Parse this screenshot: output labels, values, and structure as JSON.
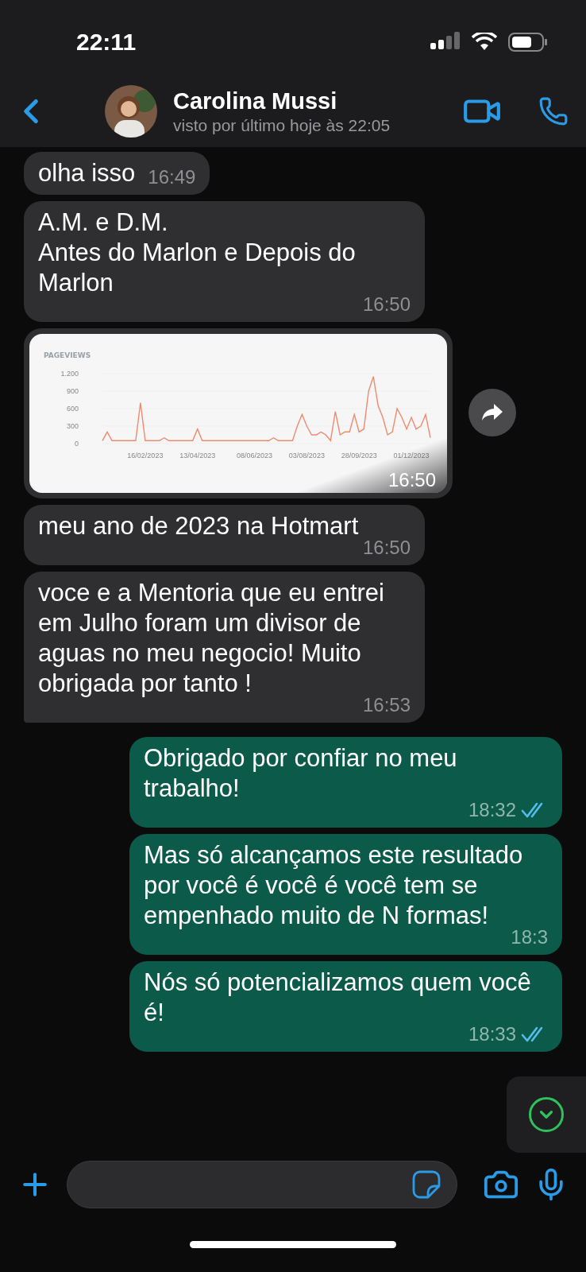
{
  "status_bar": {
    "time": "22:11"
  },
  "header": {
    "name": "Carolina Mussi",
    "last_seen": "visto por último hoje às 22:05"
  },
  "messages": [
    {
      "kind": "text",
      "outgoing": false,
      "text": "olha isso",
      "time": "16:49",
      "tail": false
    },
    {
      "kind": "text",
      "outgoing": false,
      "text": "A.M. e D.M.\nAntes do Marlon e Depois do Marlon",
      "time": "16:50",
      "tail": false
    },
    {
      "kind": "image",
      "outgoing": false,
      "time": "16:50",
      "chart_data": {
        "type": "line",
        "title": "PAGEVIEWS",
        "categories": [
          null,
          null,
          null,
          null,
          null,
          null,
          null,
          null,
          null,
          "16/02/2023",
          null,
          null,
          null,
          null,
          null,
          null,
          null,
          null,
          null,
          null,
          "13/04/2023",
          null,
          null,
          null,
          null,
          null,
          null,
          null,
          null,
          null,
          null,
          null,
          "08/06/2023",
          null,
          null,
          null,
          null,
          null,
          null,
          null,
          null,
          null,
          null,
          "03/08/2023",
          null,
          null,
          null,
          null,
          null,
          null,
          null,
          null,
          null,
          null,
          "28/09/2023",
          null,
          null,
          null,
          null,
          null,
          null,
          null,
          null,
          null,
          null,
          "01/12/2023",
          null,
          null,
          null,
          null
        ],
        "series": [
          {
            "color": "#ef8a6f",
            "values": [
              50,
              200,
              50,
              50,
              50,
              50,
              50,
              50,
              700,
              50,
              50,
              50,
              50,
              100,
              50,
              50,
              50,
              50,
              50,
              50,
              250,
              50,
              50,
              50,
              50,
              50,
              50,
              50,
              50,
              50,
              50,
              50,
              50,
              50,
              50,
              50,
              100,
              50,
              50,
              50,
              50,
              300,
              500,
              300,
              150,
              150,
              200,
              150,
              50,
              550,
              150,
              200,
              200,
              500,
              200,
              250,
              900,
              1150,
              650,
              450,
              150,
              200,
              600,
              450,
              250,
              450,
              250,
              300,
              500,
              100
            ]
          }
        ],
        "ylim": [
          0,
          1200
        ],
        "yticks": [
          0,
          300,
          600,
          900,
          {
            "value": 1200,
            "label": "1.200"
          }
        ]
      }
    },
    {
      "kind": "text",
      "outgoing": false,
      "text": "meu ano de 2023 na Hotmart",
      "time": "16:50",
      "tail": false
    },
    {
      "kind": "text",
      "outgoing": false,
      "text": "voce e a Mentoria que eu entrei em Julho foram um divisor de aguas no meu negocio! Muito obrigada por tanto !",
      "time": "16:53",
      "tail": true
    },
    {
      "kind": "text",
      "outgoing": true,
      "text": "Obrigado por confiar no meu trabalho!",
      "time": "18:32",
      "read": true,
      "tail": false
    },
    {
      "kind": "text",
      "outgoing": true,
      "text": "Mas só alcançamos este resultado por você é você é você tem se empenhado muito de N formas!",
      "time": "18:3",
      "tail": false
    },
    {
      "kind": "text",
      "outgoing": true,
      "text": "Nós só potencializamos quem você é!",
      "time": "18:33",
      "read": true,
      "tail": false
    }
  ]
}
